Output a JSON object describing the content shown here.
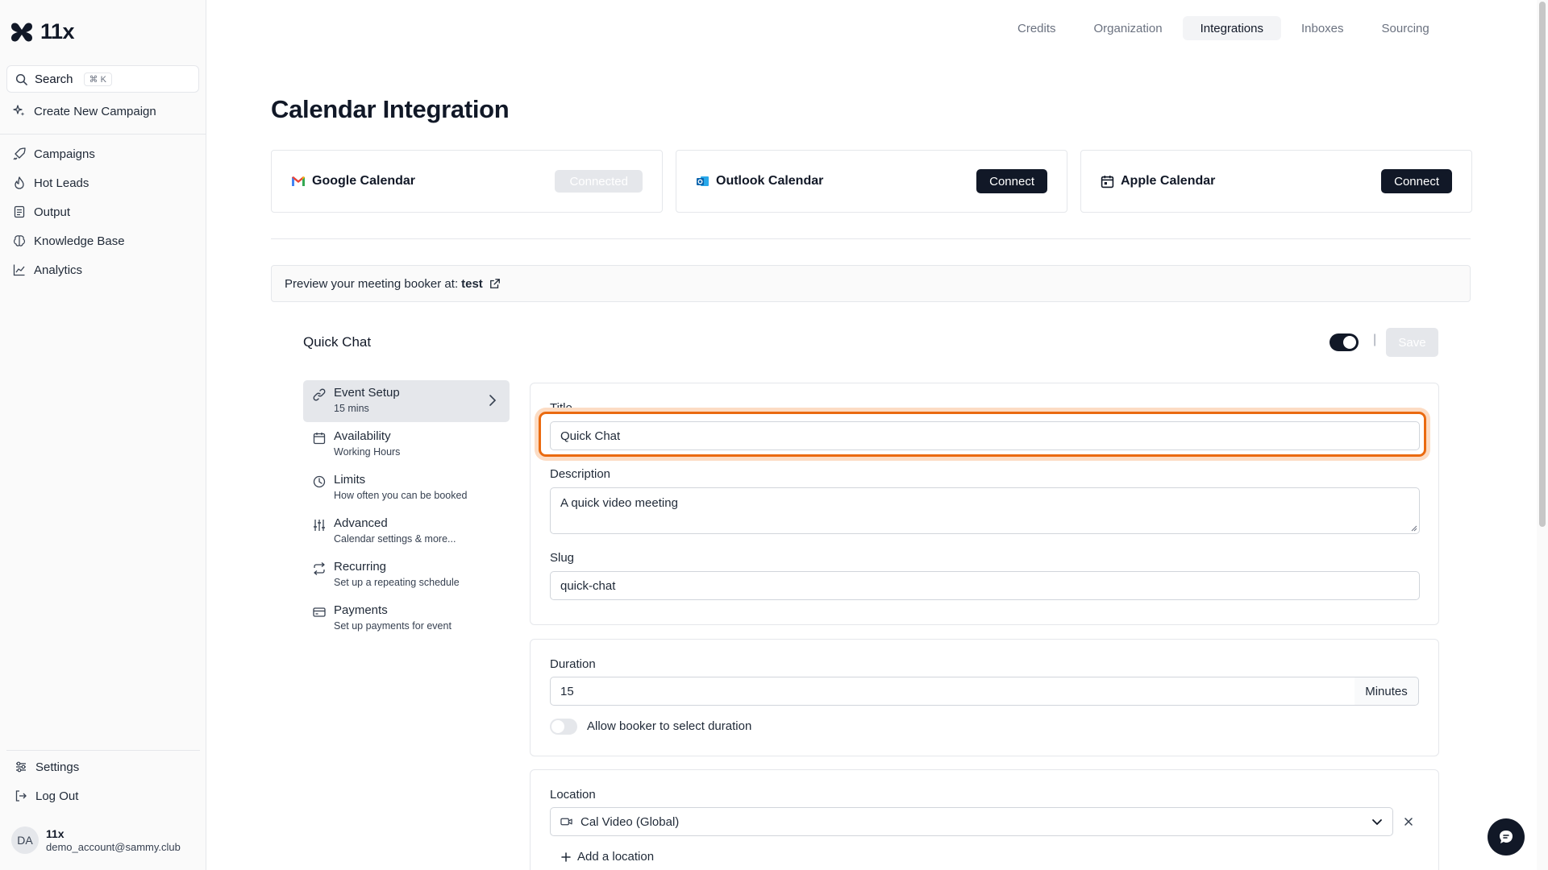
{
  "app": {
    "name": "11x"
  },
  "sidebar": {
    "search_label": "Search",
    "search_shortcut": "⌘ K",
    "create_campaign": "Create New Campaign",
    "items": [
      {
        "label": "Campaigns",
        "icon": "rocket-icon"
      },
      {
        "label": "Hot Leads",
        "icon": "flame-icon"
      },
      {
        "label": "Output",
        "icon": "document-icon"
      },
      {
        "label": "Knowledge Base",
        "icon": "brain-icon"
      },
      {
        "label": "Analytics",
        "icon": "chart-icon"
      }
    ],
    "settings": "Settings",
    "logout": "Log Out",
    "user": {
      "initials": "DA",
      "name": "11x",
      "email": "demo_account@sammy.club"
    }
  },
  "top_tabs": [
    "Credits",
    "Organization",
    "Integrations",
    "Inboxes",
    "Sourcing"
  ],
  "active_tab": "Integrations",
  "page_title": "Calendar Integration",
  "calendars": [
    {
      "name": "Google Calendar",
      "button": "Connected",
      "state": "connected",
      "icon": "gmail-icon"
    },
    {
      "name": "Outlook Calendar",
      "button": "Connect",
      "state": "disconnected",
      "icon": "outlook-icon"
    },
    {
      "name": "Apple Calendar",
      "button": "Connect",
      "state": "disconnected",
      "icon": "calendar-icon"
    }
  ],
  "preview": {
    "text": "Preview your meeting booker at:",
    "link": "test"
  },
  "event": {
    "name": "Quick Chat",
    "enabled": true,
    "save_label": "Save",
    "divider": "|"
  },
  "event_menu": [
    {
      "label": "Event Setup",
      "sub": "15 mins",
      "icon": "link-icon"
    },
    {
      "label": "Availability",
      "sub": "Working Hours",
      "icon": "calendar-icon"
    },
    {
      "label": "Limits",
      "sub": "How often you can be booked",
      "icon": "clock-icon"
    },
    {
      "label": "Advanced",
      "sub": "Calendar settings & more...",
      "icon": "sliders-icon"
    },
    {
      "label": "Recurring",
      "sub": "Set up a repeating schedule",
      "icon": "repeat-icon"
    },
    {
      "label": "Payments",
      "sub": "Set up payments for event",
      "icon": "credit-card-icon"
    }
  ],
  "form": {
    "title_label": "Title",
    "title_value": "Quick Chat",
    "description_label": "Description",
    "description_value": "A quick video meeting",
    "slug_label": "Slug",
    "slug_value": "quick-chat",
    "duration_label": "Duration",
    "duration_value": "15",
    "duration_unit": "Minutes",
    "allow_duration_label": "Allow booker to select duration",
    "allow_duration_enabled": false,
    "location_label": "Location",
    "location_value": "Cal Video (Global)",
    "add_location": "Add a location"
  },
  "colors": {
    "accent": "#111827",
    "focus": "#ea6a10"
  }
}
